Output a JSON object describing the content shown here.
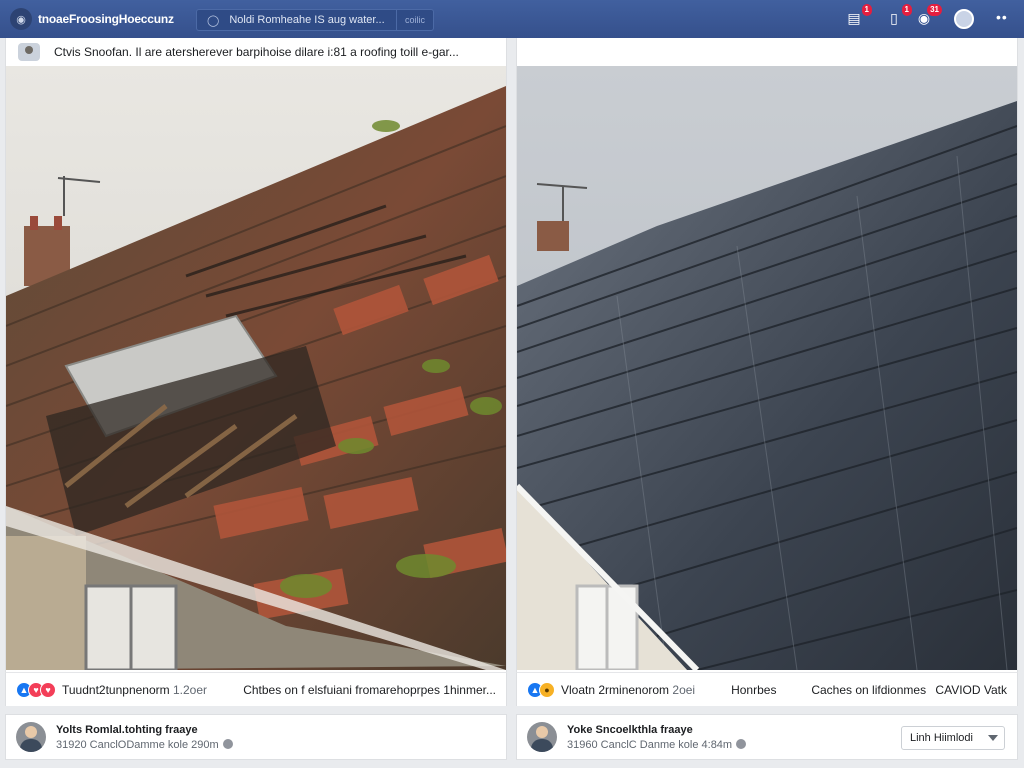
{
  "header": {
    "brand_title": "tnoaeFroosingHoeccunz",
    "search_text": "Noldi Romheahe IS aug water...",
    "search_button": "coilic",
    "icons": [
      "pages-icon",
      "messenger-icon",
      "notifications-icon",
      "profile-icon",
      "more-icon"
    ],
    "badges": {
      "pages": "1",
      "messenger": "1",
      "notifications": "31"
    }
  },
  "posts": [
    {
      "caption": "Ctvis Snoofan. Il are atersherever barpihoise dilare i:81 a roofing toill e-gar...",
      "photo": "damaged mossy tile roof",
      "reactions_text": "Tuudnt2tunpnenorm",
      "reactions_time": "1.2oer",
      "share_text": "Chtbes on f elsfuiani fromarehoprpes 1hinmer...",
      "comment_name": "Yolts Romlal.tohting fraaye",
      "comment_meta": "31920 CanclODamme kole 290m"
    },
    {
      "caption": "",
      "photo": "new dark slate roof",
      "reactions_text": "Vloatn 2rminenorom",
      "reactions_time": "2oei",
      "mid_text": "Honrbes",
      "share_text": "Caches on lifdionmes",
      "share_extra": "CAVIOD Vatk",
      "comment_name": "Yoke Sncoelkthla fraaye",
      "comment_meta": "31960 CanclC Danme kole 4:84m",
      "dropdown_label": "Linh Hiimlodi"
    }
  ],
  "colors": {
    "topbar": "#3b5998",
    "like": "#1877f2",
    "love": "#f33e58",
    "badge": "#e41e3f"
  }
}
